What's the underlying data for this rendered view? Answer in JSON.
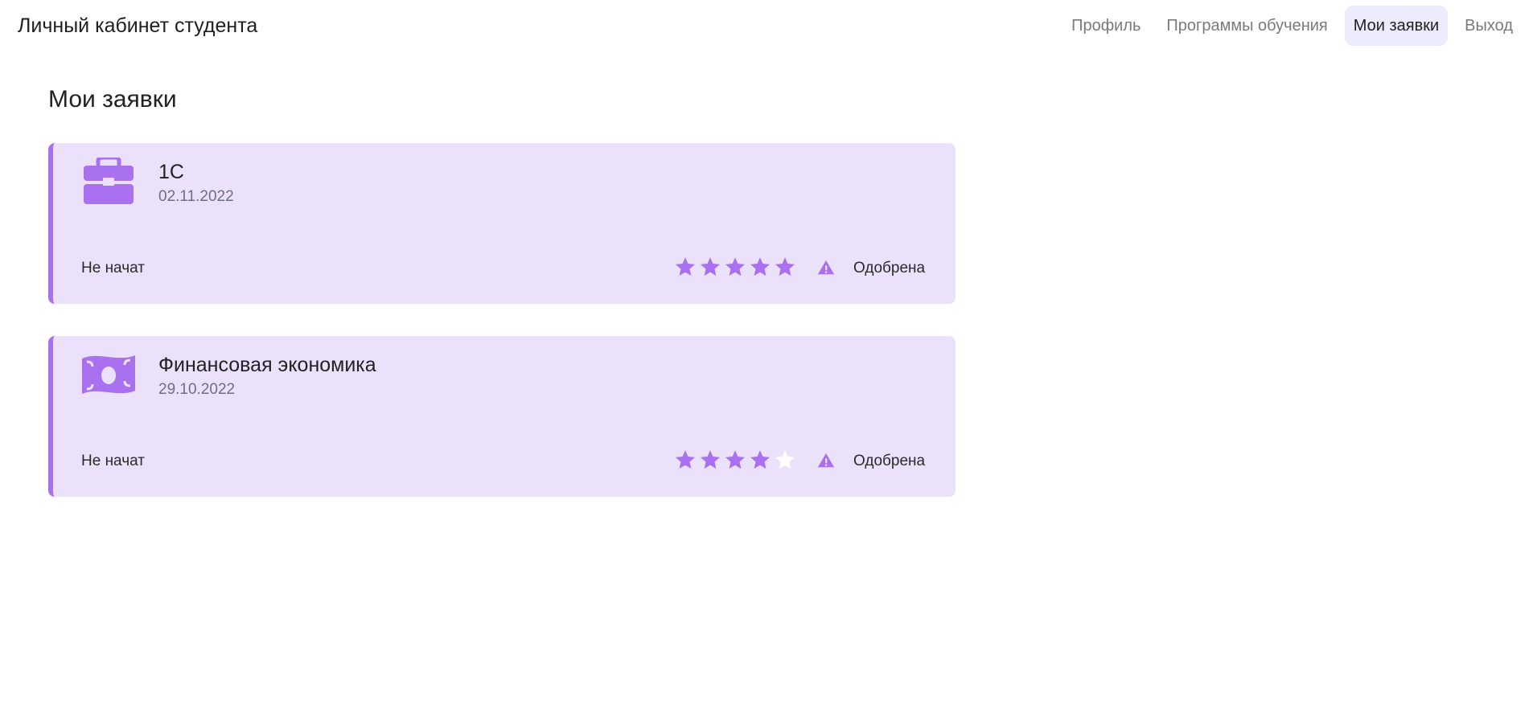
{
  "header": {
    "title": "Личный кабинет студента",
    "nav": [
      {
        "label": "Профиль",
        "active": false
      },
      {
        "label": "Программы обучения",
        "active": false
      },
      {
        "label": "Мои заявки",
        "active": true
      },
      {
        "label": "Выход",
        "active": false
      }
    ]
  },
  "main": {
    "title": "Мои заявки",
    "applications": [
      {
        "icon": "briefcase-icon",
        "name": "1С",
        "date": "02.11.2022",
        "progress": "Не начат",
        "rating": 5,
        "rating_max": 5,
        "status_icon": "warning-icon",
        "status": "Одобрена"
      },
      {
        "icon": "money-icon",
        "name": "Финансовая экономика",
        "date": "29.10.2022",
        "progress": "Не начат",
        "rating": 4,
        "rating_max": 5,
        "status_icon": "warning-icon",
        "status": "Одобрена"
      }
    ]
  },
  "colors": {
    "accent": "#a970f0",
    "card_background": "#ebe1fb",
    "active_nav_background": "#ebebfc",
    "star_empty": "#ffffff"
  }
}
